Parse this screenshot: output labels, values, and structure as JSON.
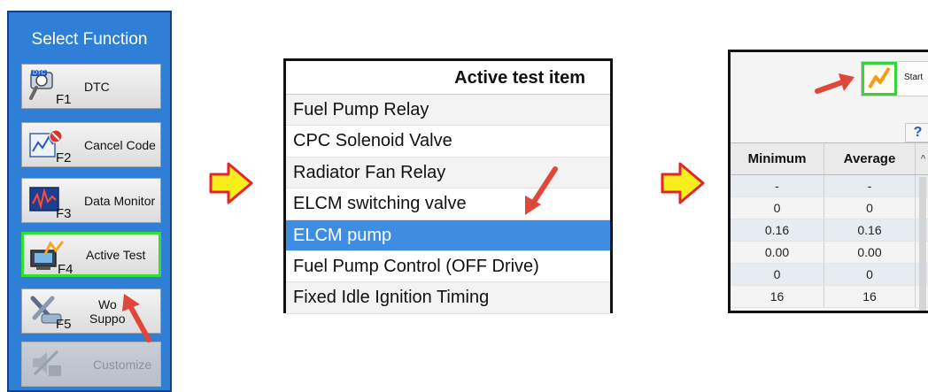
{
  "select_function": {
    "title": "Select Function",
    "buttons": [
      {
        "fkey": "F1",
        "label": "DTC",
        "icon": "dtc-scanner-icon",
        "tag": "DTC"
      },
      {
        "fkey": "F2",
        "label": "Cancel Code",
        "icon": "cancel-code-icon"
      },
      {
        "fkey": "F3",
        "label": "Data Monitor",
        "icon": "data-monitor-icon"
      },
      {
        "fkey": "F4",
        "label": "Active Test",
        "icon": "active-test-icon",
        "highlighted": true
      },
      {
        "fkey": "F5",
        "label": "Wo",
        "label2": "Suppo",
        "icon": "work-support-icon"
      },
      {
        "fkey": "",
        "label": "Customize",
        "icon": "customize-icon",
        "disabled": true
      }
    ]
  },
  "active_test": {
    "header": "Active test item",
    "items": [
      "Fuel Pump Relay",
      "CPC Solenoid Valve",
      "Radiator Fan Relay",
      "ELCM switching valve",
      "ELCM pump",
      "Fuel Pump Control (OFF Drive)",
      "Fixed Idle Ignition Timing"
    ],
    "selected_index": 4
  },
  "result_panel": {
    "start_label": "Start",
    "help_label": "?",
    "columns": [
      "Minimum",
      "Average"
    ],
    "rows": [
      [
        "-",
        "-"
      ],
      [
        "0",
        "0"
      ],
      [
        "0.16",
        "0.16"
      ],
      [
        "0.00",
        "0.00"
      ],
      [
        "0",
        "0"
      ],
      [
        "16",
        "16"
      ]
    ]
  },
  "colors": {
    "panel_blue": "#2f7fd6",
    "selected_row": "#3d8ee3",
    "highlight_green": "#2fe03a",
    "pointer_red": "#e0463a",
    "flow_arrow_fill": "#f7ee1c",
    "flow_arrow_stroke": "#e3262a"
  }
}
